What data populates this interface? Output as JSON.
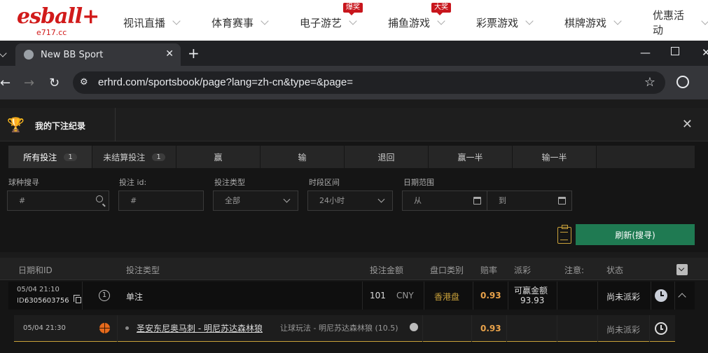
{
  "site": {
    "logo_main": "esball+",
    "logo_sub": "e717.cc",
    "nav": [
      {
        "label": "视讯直播",
        "badge": ""
      },
      {
        "label": "体育赛事",
        "badge": ""
      },
      {
        "label": "电子游艺",
        "badge": "爆奖"
      },
      {
        "label": "捕鱼游戏",
        "badge": "大奖"
      },
      {
        "label": "彩票游戏",
        "badge": ""
      },
      {
        "label": "棋牌游戏",
        "badge": ""
      },
      {
        "label": "优惠活动",
        "badge": ""
      }
    ]
  },
  "browser": {
    "tab_title": "New BB Sport",
    "url": "erhrd.com/sportsbook/page?lang=zh-cn&type=&page="
  },
  "panel": {
    "title": "我的下注纪录",
    "filter_tabs": [
      {
        "label": "所有投注",
        "count": "1"
      },
      {
        "label": "未结算投注",
        "count": "1"
      },
      {
        "label": "赢",
        "count": ""
      },
      {
        "label": "输",
        "count": ""
      },
      {
        "label": "退回",
        "count": ""
      },
      {
        "label": "赢一半",
        "count": ""
      },
      {
        "label": "输一半",
        "count": ""
      }
    ],
    "filters": {
      "sport_label": "球种搜寻",
      "sport_placeholder": "#",
      "betid_label": "投注 id:",
      "betid_placeholder": "#",
      "bettype_label": "投注类型",
      "bettype_value": "全部",
      "period_label": "时段区间",
      "period_value": "24小时",
      "date_label": "日期范围",
      "date_from": "从",
      "date_to": "到"
    },
    "refresh_label": "刷新(搜寻)"
  },
  "table": {
    "headers": {
      "date_id": "日期和ID",
      "bet_type": "投注类型",
      "amount": "投注金额",
      "odds_type": "盘口类别",
      "odds": "赔率",
      "payout": "派彩",
      "note": "注意:",
      "status": "状态"
    },
    "bet": {
      "date": "05/04 21:10",
      "id_label": "ID:",
      "id": "6305603756",
      "num": "1",
      "type": "单注",
      "amount": "101",
      "currency": "CNY",
      "odds_type": "香港盘",
      "odds": "0.93",
      "payout_label": "可赢金额",
      "payout_value": "93.93",
      "status": "尚未派彩"
    },
    "leg": {
      "date": "05/04 21:30",
      "match": "圣安东尼奥马刺 - 明尼苏达森林狼",
      "market": "让球玩法 - 明尼苏达森林狼 (10.5)",
      "odds": "0.93",
      "status": "尚未派彩"
    }
  },
  "colors": {
    "brand_red": "#d11a1a",
    "accent_gold": "#c9a13a",
    "refresh_green": "#1f7a52",
    "odds_orange": "#e8a24a"
  }
}
